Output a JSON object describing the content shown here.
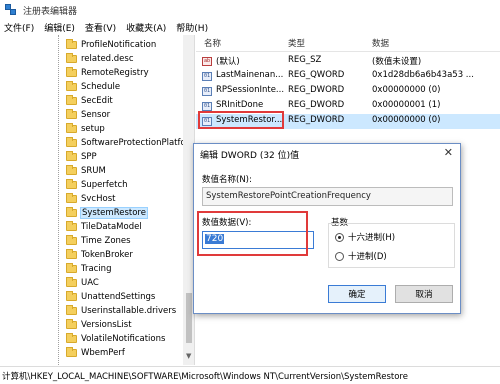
{
  "window": {
    "title": "注册表编辑器"
  },
  "menu": [
    "文件(F)",
    "编辑(E)",
    "查看(V)",
    "收藏夹(A)",
    "帮助(H)"
  ],
  "tree": {
    "items": [
      "ProfileNotification",
      "related.desc",
      "RemoteRegistry",
      "Schedule",
      "SecEdit",
      "Sensor",
      "setup",
      "SoftwareProtectionPlatfor",
      "SPP",
      "SRUM",
      "Superfetch",
      "SvcHost",
      "SystemRestore",
      "TileDataModel",
      "Time Zones",
      "TokenBroker",
      "Tracing",
      "UAC",
      "UnattendSettings",
      "Userinstallable.drivers",
      "VersionsList",
      "VolatileNotifications",
      "WbemPerf"
    ],
    "selected": "SystemRestore"
  },
  "list": {
    "headers": {
      "name": "名称",
      "type": "类型",
      "data": "数据"
    },
    "rows": [
      {
        "icon": "ab",
        "name": "(默认)",
        "type": "REG_SZ",
        "data": "(数值未设置)"
      },
      {
        "icon": "01",
        "name": "LastMainenan...",
        "type": "REG_QWORD",
        "data": "0x1d28db6a6b43a53 ..."
      },
      {
        "icon": "01",
        "name": "RPSessionInte...",
        "type": "REG_DWORD",
        "data": "0x00000000 (0)"
      },
      {
        "icon": "01",
        "name": "SRInitDone",
        "type": "REG_DWORD",
        "data": "0x00000001 (1)"
      },
      {
        "icon": "01",
        "name": "SystemRestor...",
        "type": "REG_DWORD",
        "data": "0x00000000 (0)"
      }
    ]
  },
  "dialog": {
    "title": "编辑 DWORD (32 位)值",
    "close": "✕",
    "name_label": "数值名称(N):",
    "name_value": "SystemRestorePointCreationFrequency",
    "data_label": "数值数据(V):",
    "data_value": "720",
    "base_label": "基数",
    "hex_label": "十六进制(H)",
    "dec_label": "十进制(D)",
    "ok": "确定",
    "cancel": "取消"
  },
  "status": {
    "path": "计算机\\HKEY_LOCAL_MACHINE\\SOFTWARE\\Microsoft\\Windows NT\\CurrentVersion\\SystemRestore"
  },
  "colors": {
    "highlight": "#e03a3a",
    "selection": "#cce8ff",
    "accent": "#3a7bd5"
  }
}
